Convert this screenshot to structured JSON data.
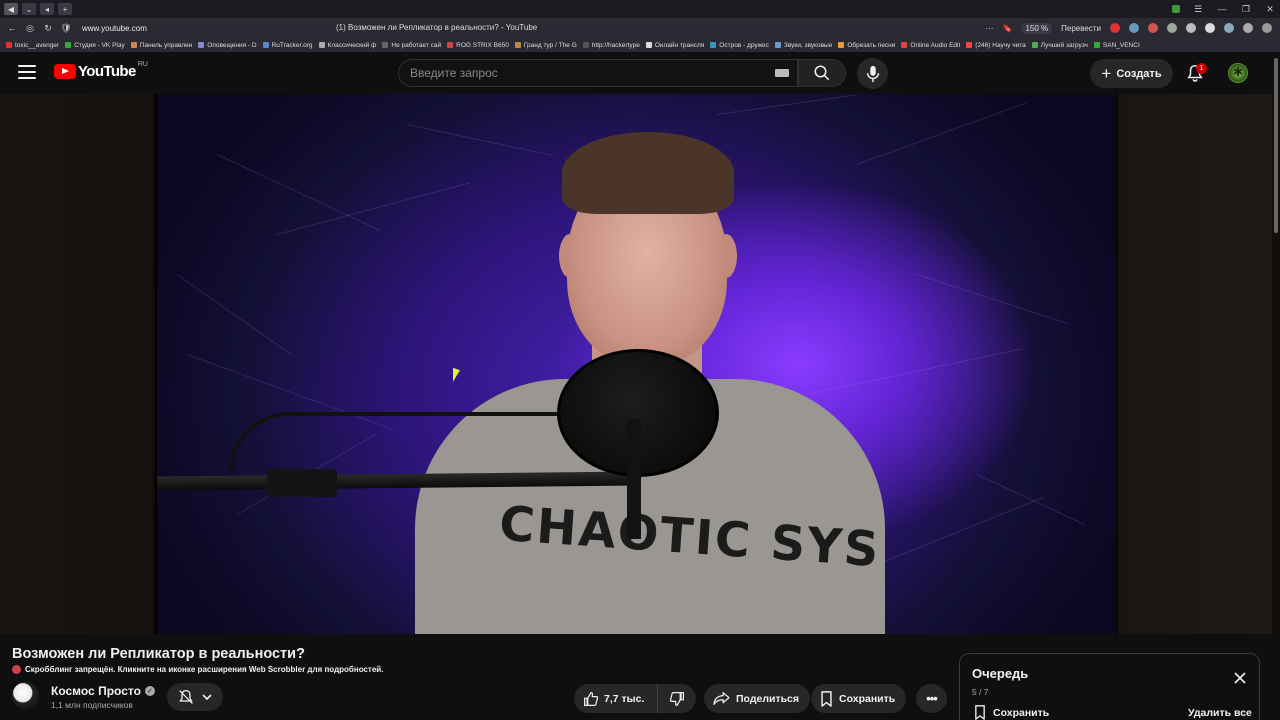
{
  "browser": {
    "url": "www.youtube.com",
    "tab_title": "(1) Возможен ли Репликатор в реальности? - YouTube",
    "zoom": "150 %",
    "translate_label": "Перевести"
  },
  "bookmarks": [
    "toxic__avenger",
    "Студия - VK Play",
    "Панель управлен",
    "Оповещения - D",
    "RuTracker.org",
    "Классический ф",
    "Не работает сай",
    "ROG STRIX B650",
    "Гранд тур / The G",
    "http://hackertype",
    "Онлайн трансля",
    "Остров - дружес",
    "Звуки, звуковые",
    "Обрезать песни",
    "Online Audio Edit",
    "(246) Научу чита",
    "Лучший загрузч",
    "SAN_VENCI"
  ],
  "masthead": {
    "logo_text": "YouTube",
    "region": "RU",
    "search_placeholder": "Введите запрос",
    "create_label": "Создать",
    "notification_count": "1"
  },
  "video": {
    "title": "Возможен ли Репликатор в реальности?",
    "scrobble_notice": "Скробблинг запрещён. Кликните на иконке расширения Web Scrobbler для подробностей.",
    "shirt_text": "CHAOTIC SYS"
  },
  "channel": {
    "name": "Космос Просто",
    "subscribers": "1,1 млн подписчиков"
  },
  "actions": {
    "likes": "7,7 тыс.",
    "share_label": "Поделиться",
    "save_label": "Сохранить"
  },
  "queue": {
    "title": "Очередь",
    "position": "5 / 7",
    "save_label": "Сохранить",
    "clear_label": "Удалить все"
  },
  "colors": {
    "background": "#0f0f0f",
    "brand_red": "#ff0000",
    "button_bg": "#272727",
    "secondary_text": "#aaaaaa"
  }
}
